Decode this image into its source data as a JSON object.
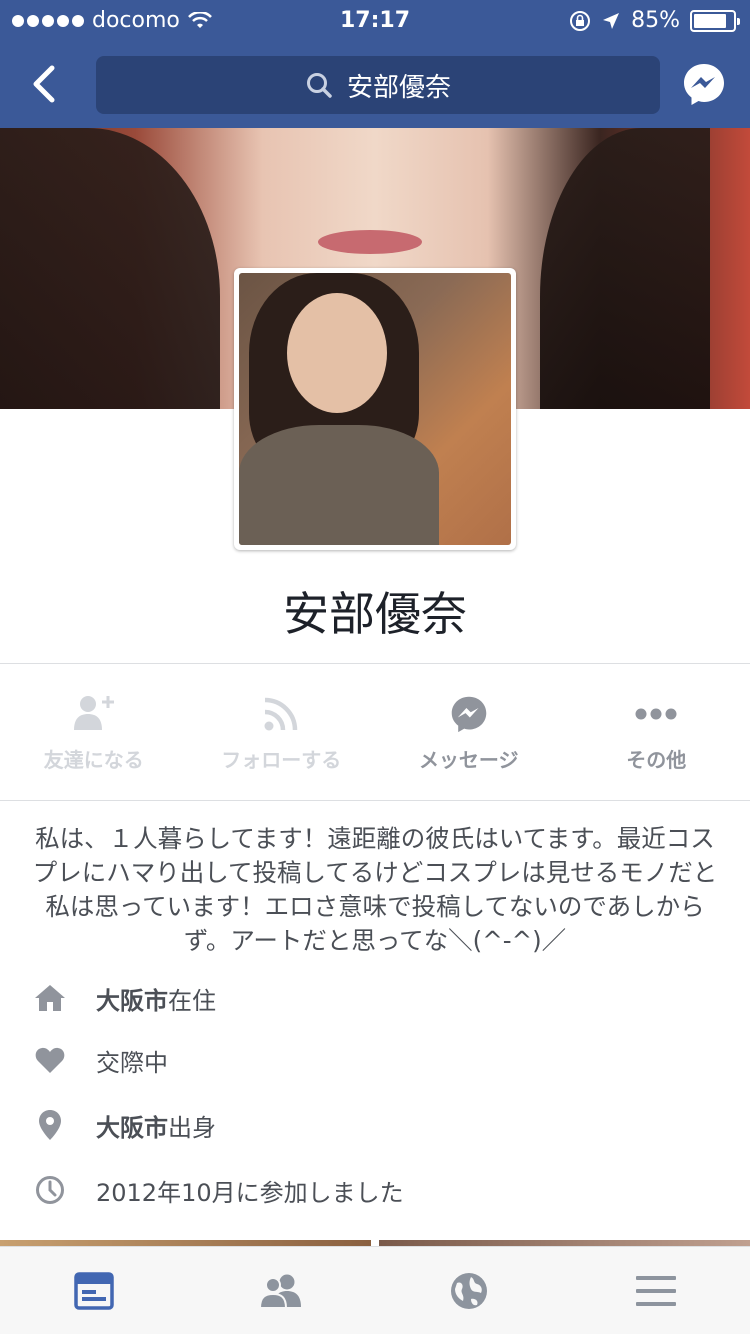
{
  "status_bar": {
    "carrier": "docomo",
    "time": "17:17",
    "battery": "85%",
    "battery_level": 0.85
  },
  "nav": {
    "back_icon": "chevron-left-icon",
    "search_text": "安部優奈",
    "messenger_icon": "messenger-icon"
  },
  "profile": {
    "name": "安部優奈"
  },
  "actions": [
    {
      "label": "友達になる",
      "icon": "add-friend-icon",
      "enabled": false
    },
    {
      "label": "フォローする",
      "icon": "rss-icon",
      "enabled": false
    },
    {
      "label": "メッセージ",
      "icon": "messenger-icon",
      "enabled": true
    },
    {
      "label": "その他",
      "icon": "more-icon",
      "enabled": true
    }
  ],
  "bio": "私は、１人暮らしてます！遠距離の彼氏はいてます。最近コスプレにハマり出して投稿してるけどコスプレは見せるモノだと私は思っています！エロさ意味で投稿してないのであしからず。アートだと思ってな＼(^-^)／",
  "info": [
    {
      "icon": "home-icon",
      "bold": "大阪市",
      "text": "在住"
    },
    {
      "icon": "heart-icon",
      "bold": "",
      "text": "交際中"
    },
    {
      "icon": "location-pin-icon",
      "bold": "大阪市",
      "text": "出身"
    },
    {
      "icon": "clock-icon",
      "bold": "",
      "text": "2012年10月に参加しました"
    }
  ],
  "tabbar": [
    {
      "icon": "news-feed-icon",
      "active": true
    },
    {
      "icon": "friends-icon",
      "active": false
    },
    {
      "icon": "globe-icon",
      "active": false
    },
    {
      "icon": "menu-icon",
      "active": false
    }
  ],
  "colors": {
    "brand": "#3b5998",
    "active_tab": "#4267b2",
    "inactive_icon": "#8d949e"
  }
}
